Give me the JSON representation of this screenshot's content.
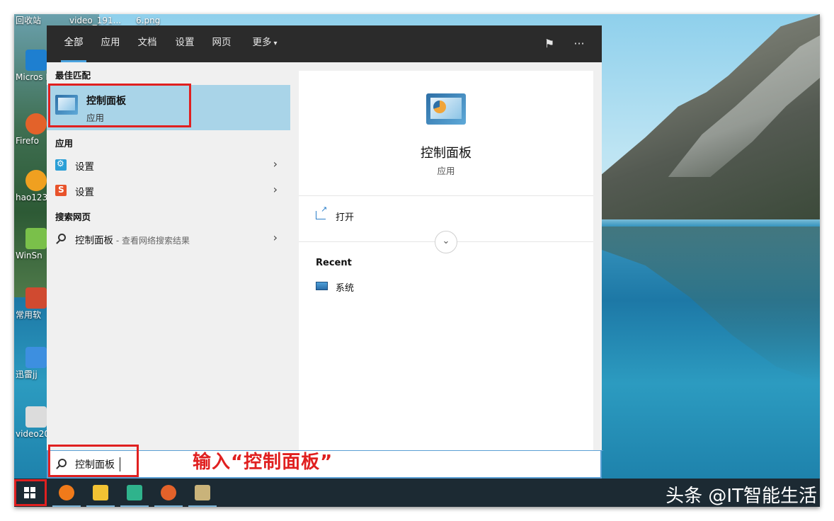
{
  "desktop": {
    "icons": [
      {
        "label": "回收站"
      },
      {
        "label": "video_191..."
      },
      {
        "label": "6.png"
      },
      {
        "label": "Micros Edg"
      },
      {
        "label": "Firefo"
      },
      {
        "label": "hao123"
      },
      {
        "label": "WinSn"
      },
      {
        "label": "常用软"
      },
      {
        "label": "迅雷jj"
      },
      {
        "label": "video20"
      }
    ]
  },
  "search": {
    "tabs": [
      {
        "label": "全部"
      },
      {
        "label": "应用"
      },
      {
        "label": "文档"
      },
      {
        "label": "设置"
      },
      {
        "label": "网页"
      },
      {
        "label": "更多"
      }
    ],
    "more_caret": "▾",
    "feedback_glyph": "⚑",
    "more_options_glyph": "···",
    "best_match_heading": "最佳匹配",
    "best_match": {
      "name": "控制面板",
      "type": "应用"
    },
    "apps_heading": "应用",
    "apps": [
      {
        "label": "设置",
        "icon": "settings-gear-icon",
        "color": "#2b9fd6"
      },
      {
        "label": "设置",
        "icon": "sogou-settings-icon",
        "color": "#e8532b"
      }
    ],
    "web_heading": "搜索网页",
    "web_result": {
      "label": "控制面板",
      "suffix": " - 查看网络搜索结果"
    },
    "chevron": "›",
    "detail": {
      "title": "控制面板",
      "subtitle": "应用",
      "open_label": "打开",
      "expand_glyph": "⌄",
      "recent_heading": "Recent",
      "recent_items": [
        {
          "label": "系统"
        }
      ]
    },
    "input_value": "控制面板"
  },
  "annotation": "输入“控制面板”",
  "taskbar": {
    "apps": [
      {
        "name": "taskbar-orange-app-icon",
        "color": "#f07a1a"
      },
      {
        "name": "taskbar-file-explorer-icon",
        "color": "#f2c233"
      },
      {
        "name": "taskbar-media-player-icon",
        "color": "#2fb38c"
      },
      {
        "name": "taskbar-firefox-icon",
        "color": "#e3622a"
      },
      {
        "name": "taskbar-paint-app-icon",
        "color": "#c9b37a"
      }
    ]
  },
  "watermark": "头条 @IT智能生活",
  "colors": {
    "accent": "#4aa3df",
    "highlight": "#e02020",
    "selected_row": "#a9d4e8"
  }
}
